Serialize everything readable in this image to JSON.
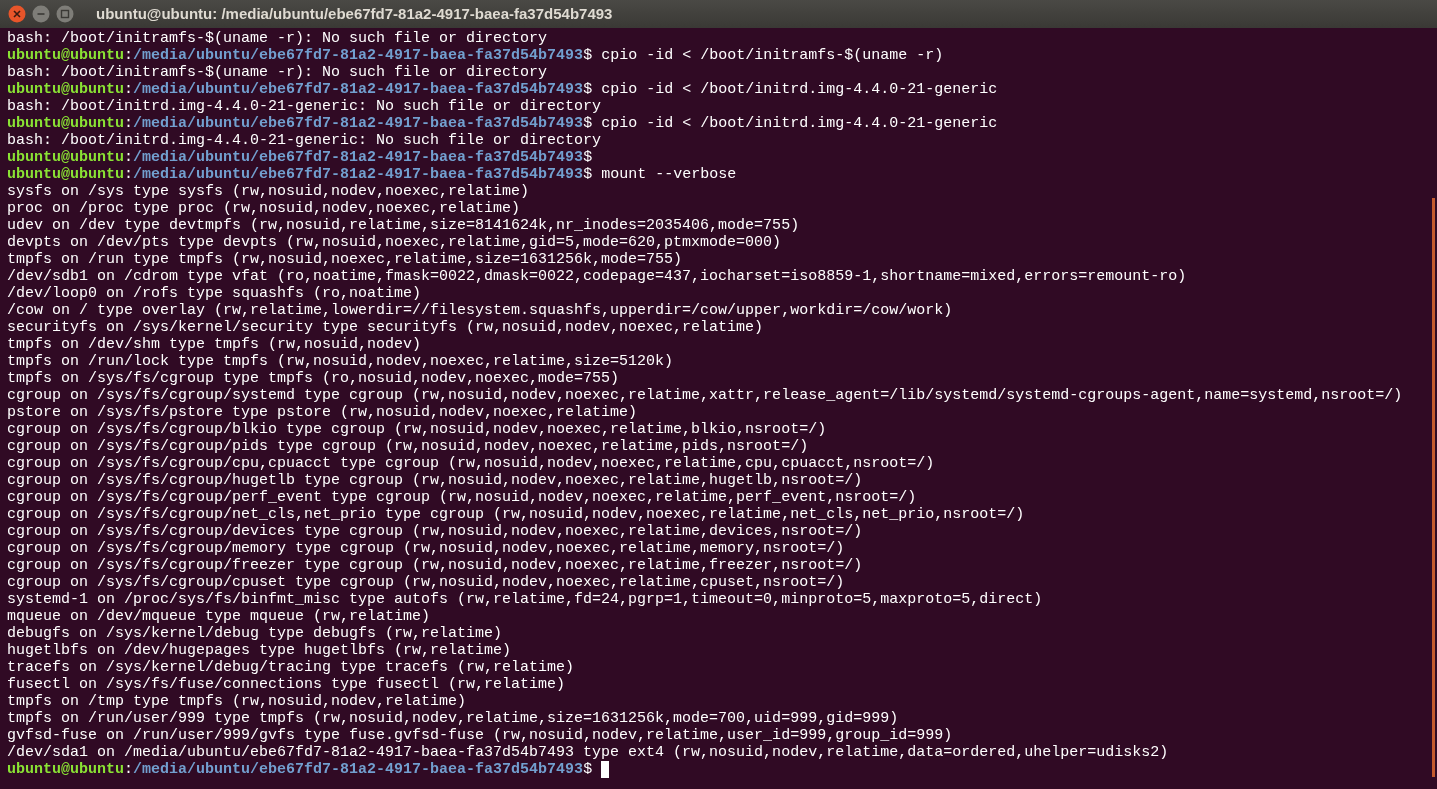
{
  "window": {
    "title": "ubuntu@ubuntu: /media/ubuntu/ebe67fd7-81a2-4917-baea-fa37d54b7493"
  },
  "lines": [
    {
      "kind": "output",
      "text": "bash: /boot/initramfs-$(uname -r): No such file or directory"
    },
    {
      "kind": "prompt",
      "user": "ubuntu@ubuntu",
      "sep": ":",
      "path": "/media/ubuntu/ebe67fd7-81a2-4917-baea-fa37d54b7493",
      "sign": "$",
      "command": "cpio -id < /boot/initramfs-$(uname -r)"
    },
    {
      "kind": "output",
      "text": "bash: /boot/initramfs-$(uname -r): No such file or directory"
    },
    {
      "kind": "prompt",
      "user": "ubuntu@ubuntu",
      "sep": ":",
      "path": "/media/ubuntu/ebe67fd7-81a2-4917-baea-fa37d54b7493",
      "sign": "$",
      "command": "cpio -id < /boot/initrd.img-4.4.0-21-generic"
    },
    {
      "kind": "output",
      "text": "bash: /boot/initrd.img-4.4.0-21-generic: No such file or directory"
    },
    {
      "kind": "prompt",
      "user": "ubuntu@ubuntu",
      "sep": ":",
      "path": "/media/ubuntu/ebe67fd7-81a2-4917-baea-fa37d54b7493",
      "sign": "$",
      "command": "cpio -id < /boot/initrd.img-4.4.0-21-generic"
    },
    {
      "kind": "output",
      "text": "bash: /boot/initrd.img-4.4.0-21-generic: No such file or directory"
    },
    {
      "kind": "prompt",
      "user": "ubuntu@ubuntu",
      "sep": ":",
      "path": "/media/ubuntu/ebe67fd7-81a2-4917-baea-fa37d54b7493",
      "sign": "$"
    },
    {
      "kind": "prompt",
      "user": "ubuntu@ubuntu",
      "sep": ":",
      "path": "/media/ubuntu/ebe67fd7-81a2-4917-baea-fa37d54b7493",
      "sign": "$",
      "command": "mount --verbose"
    },
    {
      "kind": "output",
      "text": "sysfs on /sys type sysfs (rw,nosuid,nodev,noexec,relatime)"
    },
    {
      "kind": "output",
      "text": "proc on /proc type proc (rw,nosuid,nodev,noexec,relatime)"
    },
    {
      "kind": "output",
      "text": "udev on /dev type devtmpfs (rw,nosuid,relatime,size=8141624k,nr_inodes=2035406,mode=755)"
    },
    {
      "kind": "output",
      "text": "devpts on /dev/pts type devpts (rw,nosuid,noexec,relatime,gid=5,mode=620,ptmxmode=000)"
    },
    {
      "kind": "output",
      "text": "tmpfs on /run type tmpfs (rw,nosuid,noexec,relatime,size=1631256k,mode=755)"
    },
    {
      "kind": "output",
      "text": "/dev/sdb1 on /cdrom type vfat (ro,noatime,fmask=0022,dmask=0022,codepage=437,iocharset=iso8859-1,shortname=mixed,errors=remount-ro)"
    },
    {
      "kind": "output",
      "text": "/dev/loop0 on /rofs type squashfs (ro,noatime)"
    },
    {
      "kind": "output",
      "text": "/cow on / type overlay (rw,relatime,lowerdir=//filesystem.squashfs,upperdir=/cow/upper,workdir=/cow/work)"
    },
    {
      "kind": "output",
      "text": "securityfs on /sys/kernel/security type securityfs (rw,nosuid,nodev,noexec,relatime)"
    },
    {
      "kind": "output",
      "text": "tmpfs on /dev/shm type tmpfs (rw,nosuid,nodev)"
    },
    {
      "kind": "output",
      "text": "tmpfs on /run/lock type tmpfs (rw,nosuid,nodev,noexec,relatime,size=5120k)"
    },
    {
      "kind": "output",
      "text": "tmpfs on /sys/fs/cgroup type tmpfs (ro,nosuid,nodev,noexec,mode=755)"
    },
    {
      "kind": "output",
      "text": "cgroup on /sys/fs/cgroup/systemd type cgroup (rw,nosuid,nodev,noexec,relatime,xattr,release_agent=/lib/systemd/systemd-cgroups-agent,name=systemd,nsroot=/)"
    },
    {
      "kind": "output",
      "text": "pstore on /sys/fs/pstore type pstore (rw,nosuid,nodev,noexec,relatime)"
    },
    {
      "kind": "output",
      "text": "cgroup on /sys/fs/cgroup/blkio type cgroup (rw,nosuid,nodev,noexec,relatime,blkio,nsroot=/)"
    },
    {
      "kind": "output",
      "text": "cgroup on /sys/fs/cgroup/pids type cgroup (rw,nosuid,nodev,noexec,relatime,pids,nsroot=/)"
    },
    {
      "kind": "output",
      "text": "cgroup on /sys/fs/cgroup/cpu,cpuacct type cgroup (rw,nosuid,nodev,noexec,relatime,cpu,cpuacct,nsroot=/)"
    },
    {
      "kind": "output",
      "text": "cgroup on /sys/fs/cgroup/hugetlb type cgroup (rw,nosuid,nodev,noexec,relatime,hugetlb,nsroot=/)"
    },
    {
      "kind": "output",
      "text": "cgroup on /sys/fs/cgroup/perf_event type cgroup (rw,nosuid,nodev,noexec,relatime,perf_event,nsroot=/)"
    },
    {
      "kind": "output",
      "text": "cgroup on /sys/fs/cgroup/net_cls,net_prio type cgroup (rw,nosuid,nodev,noexec,relatime,net_cls,net_prio,nsroot=/)"
    },
    {
      "kind": "output",
      "text": "cgroup on /sys/fs/cgroup/devices type cgroup (rw,nosuid,nodev,noexec,relatime,devices,nsroot=/)"
    },
    {
      "kind": "output",
      "text": "cgroup on /sys/fs/cgroup/memory type cgroup (rw,nosuid,nodev,noexec,relatime,memory,nsroot=/)"
    },
    {
      "kind": "output",
      "text": "cgroup on /sys/fs/cgroup/freezer type cgroup (rw,nosuid,nodev,noexec,relatime,freezer,nsroot=/)"
    },
    {
      "kind": "output",
      "text": "cgroup on /sys/fs/cgroup/cpuset type cgroup (rw,nosuid,nodev,noexec,relatime,cpuset,nsroot=/)"
    },
    {
      "kind": "output",
      "text": "systemd-1 on /proc/sys/fs/binfmt_misc type autofs (rw,relatime,fd=24,pgrp=1,timeout=0,minproto=5,maxproto=5,direct)"
    },
    {
      "kind": "output",
      "text": "mqueue on /dev/mqueue type mqueue (rw,relatime)"
    },
    {
      "kind": "output",
      "text": "debugfs on /sys/kernel/debug type debugfs (rw,relatime)"
    },
    {
      "kind": "output",
      "text": "hugetlbfs on /dev/hugepages type hugetlbfs (rw,relatime)"
    },
    {
      "kind": "output",
      "text": "tracefs on /sys/kernel/debug/tracing type tracefs (rw,relatime)"
    },
    {
      "kind": "output",
      "text": "fusectl on /sys/fs/fuse/connections type fusectl (rw,relatime)"
    },
    {
      "kind": "output",
      "text": "tmpfs on /tmp type tmpfs (rw,nosuid,nodev,relatime)"
    },
    {
      "kind": "output",
      "text": "tmpfs on /run/user/999 type tmpfs (rw,nosuid,nodev,relatime,size=1631256k,mode=700,uid=999,gid=999)"
    },
    {
      "kind": "output",
      "text": "gvfsd-fuse on /run/user/999/gvfs type fuse.gvfsd-fuse (rw,nosuid,nodev,relatime,user_id=999,group_id=999)"
    },
    {
      "kind": "output",
      "text": "/dev/sda1 on /media/ubuntu/ebe67fd7-81a2-4917-baea-fa37d54b7493 type ext4 (rw,nosuid,nodev,relatime,data=ordered,uhelper=udisks2)"
    },
    {
      "kind": "prompt",
      "user": "ubuntu@ubuntu",
      "sep": ":",
      "path": "/media/ubuntu/ebe67fd7-81a2-4917-baea-fa37d54b7493",
      "sign": "$",
      "cursor": true
    }
  ]
}
